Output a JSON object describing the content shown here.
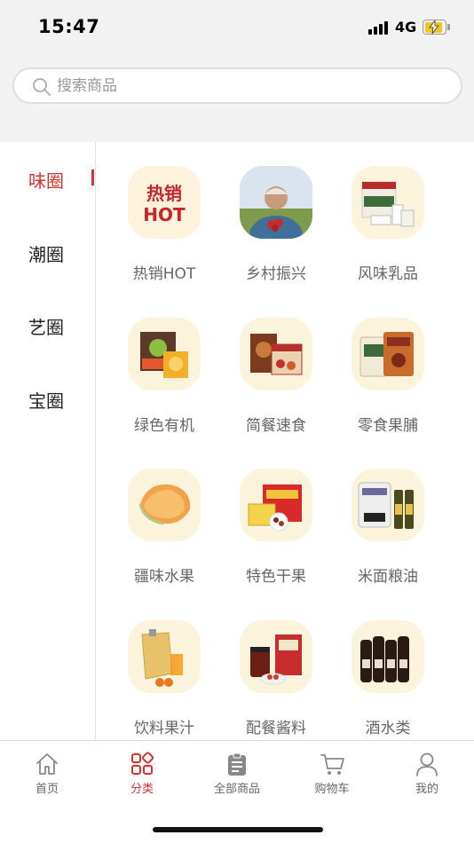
{
  "status_bar": {
    "time": "15:47",
    "network": "4G"
  },
  "search": {
    "placeholder": "搜索商品",
    "value": ""
  },
  "sidebar": {
    "items": [
      {
        "label": "味圈",
        "active": true
      },
      {
        "label": "潮圈",
        "active": false
      },
      {
        "label": "艺圈",
        "active": false
      },
      {
        "label": "宝圈",
        "active": false
      }
    ]
  },
  "categories": [
    {
      "label": "热销HOT",
      "icon": "hot-sale-icon",
      "icon_text_top": "热销",
      "icon_text_bottom": "HOT"
    },
    {
      "label": "乡村振兴",
      "icon": "farmer-photo"
    },
    {
      "label": "风味乳品",
      "icon": "dairy-box-photo"
    },
    {
      "label": "绿色有机",
      "icon": "organic-food-photo"
    },
    {
      "label": "简餐速食",
      "icon": "instant-food-photo"
    },
    {
      "label": "零食果脯",
      "icon": "snack-bag-photo"
    },
    {
      "label": "疆味水果",
      "icon": "melon-photo"
    },
    {
      "label": "特色干果",
      "icon": "dried-fruit-box-photo"
    },
    {
      "label": "米面粮油",
      "icon": "rice-oil-photo"
    },
    {
      "label": "饮料果汁",
      "icon": "juice-pouch-photo"
    },
    {
      "label": "配餐酱料",
      "icon": "sauce-jar-photo"
    },
    {
      "label": "酒水类",
      "icon": "bottles-photo"
    }
  ],
  "tabbar": {
    "items": [
      {
        "label": "首页",
        "icon": "home-icon",
        "active": false
      },
      {
        "label": "分类",
        "icon": "category-grid-icon",
        "active": true
      },
      {
        "label": "全部商品",
        "icon": "clipboard-icon",
        "active": false
      },
      {
        "label": "购物车",
        "icon": "cart-icon",
        "active": false
      },
      {
        "label": "我的",
        "icon": "user-icon",
        "active": false
      }
    ]
  },
  "colors": {
    "accent": "#d6312c",
    "thumb_bg": "#fcf3dd",
    "header_bg": "#f2f2f2"
  }
}
